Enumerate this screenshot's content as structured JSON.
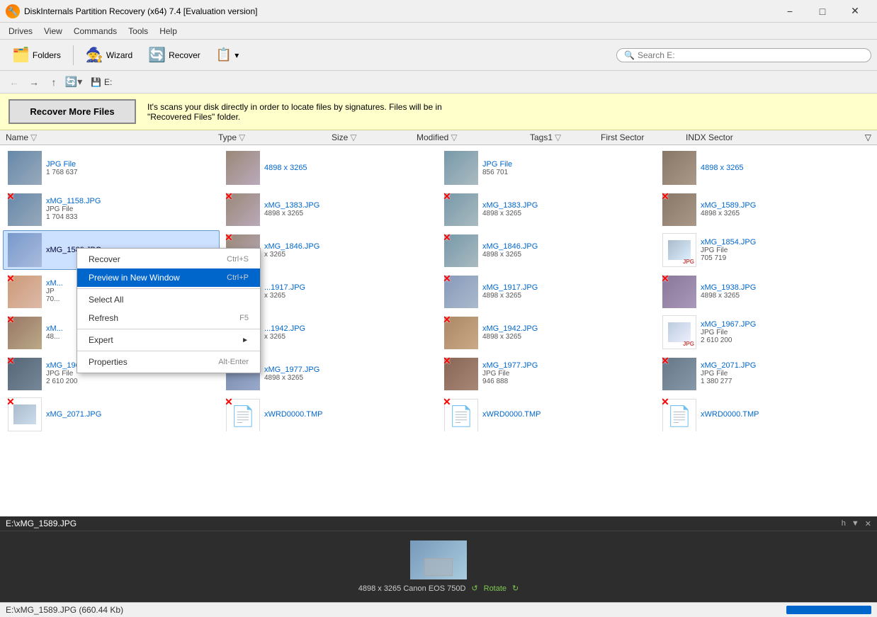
{
  "window": {
    "title": "DiskInternals Partition Recovery (x64) 7.4 [Evaluation version]"
  },
  "menu": {
    "items": [
      "Drives",
      "View",
      "Commands",
      "Tools",
      "Help"
    ]
  },
  "toolbar": {
    "folders_label": "Folders",
    "wizard_label": "Wizard",
    "recover_label": "Recover",
    "search_placeholder": "Search E:"
  },
  "nav": {
    "path": "E:"
  },
  "banner": {
    "button_label": "Recover More Files",
    "text_line1": "It's scans your disk directly in order to locate files by signatures. Files will be in",
    "text_line2": "\"Recovered Files\" folder."
  },
  "columns": {
    "name": "Name",
    "type": "Type",
    "size": "Size",
    "modified": "Modified",
    "tags1": "Tags1",
    "first_sector": "First Sector",
    "indx_sector": "INDX Sector"
  },
  "files": [
    {
      "name": "JPG File",
      "details": "4898 x 3265",
      "row": 0,
      "col": 0,
      "has_thumb": true,
      "thumb_type": "1"
    },
    {
      "name": "JPG File",
      "details": "4898 x 3265",
      "row": 0,
      "col": 1,
      "has_thumb": true,
      "thumb_type": "2"
    },
    {
      "name": "JPG File",
      "details": "856 701",
      "row": 0,
      "col": 2,
      "has_thumb": true,
      "thumb_type": "3"
    },
    {
      "name": "JPG File",
      "details": "4898 x 3265",
      "row": 0,
      "col": 3,
      "has_thumb": true,
      "thumb_type": "4"
    },
    {
      "name": "xMG_1158.JPG",
      "type": "JPG File",
      "size": "1 704 833",
      "row": 1,
      "col": 0,
      "has_x": true,
      "thumb_type": "1"
    },
    {
      "name": "xMG_1383.JPG",
      "type": "4898 x 3265",
      "row": 1,
      "col": 1,
      "has_x": true,
      "thumb_type": "2"
    },
    {
      "name": "xMG_1383.JPG",
      "type": "4898 x 3265",
      "row": 1,
      "col": 2,
      "has_x": true,
      "thumb_type": "3"
    },
    {
      "name": "xMG_1589.JPG",
      "type": "4898 x 3265",
      "row": 1,
      "col": 3,
      "has_x": true,
      "thumb_type": "4"
    },
    {
      "name": "xMG_1589.JPG",
      "selected": true,
      "row": 2,
      "col": 0,
      "has_x": false,
      "thumb_type": "5"
    },
    {
      "name": "xMG_1846.JPG",
      "details": "x 3265",
      "row": 2,
      "col": 1,
      "has_x": true,
      "thumb_type": "2"
    },
    {
      "name": "xMG_1846.JPG",
      "type": "4898 x 3265",
      "row": 2,
      "col": 2,
      "has_x": true,
      "thumb_type": "3"
    },
    {
      "name": "xMG_1854.JPG",
      "type": "JPG File",
      "size": "705 719",
      "row": 2,
      "col": 3,
      "has_x": true,
      "thumb_type": "icon"
    },
    {
      "name": "xM...",
      "type": "JP",
      "size": "70...",
      "row": 3,
      "col": 0,
      "has_x": true,
      "thumb_type": "1"
    },
    {
      "name": "...1917.JPG",
      "type": "x 3265",
      "row": 3,
      "col": 1,
      "has_x": true,
      "thumb_type": "2"
    },
    {
      "name": "xMG_1917.JPG",
      "type": "4898 x 3265",
      "row": 3,
      "col": 2,
      "has_x": true,
      "thumb_type": "3"
    },
    {
      "name": "xMG_1938.JPG",
      "type": "4898 x 3265",
      "row": 3,
      "col": 3,
      "has_x": true,
      "thumb_type": "4"
    },
    {
      "name": "xM...",
      "details": "48...",
      "row": 4,
      "col": 0,
      "has_x": true,
      "thumb_type": "1"
    },
    {
      "name": "...1942.JPG",
      "type": "x 3265",
      "row": 4,
      "col": 1,
      "has_x": true,
      "thumb_type": "2"
    },
    {
      "name": "xMG_1942.JPG",
      "type": "4898 x 3265",
      "row": 4,
      "col": 2,
      "has_x": true,
      "thumb_type": "3"
    },
    {
      "name": "xMG_1967.JPG",
      "type": "JPG File",
      "size": "2 610 200",
      "row": 4,
      "col": 3,
      "has_x": true,
      "thumb_type": "icon"
    },
    {
      "name": "xMG_1967.JPG",
      "type": "JPG File",
      "size": "2 610 200",
      "row": 5,
      "col": 0,
      "has_x": true,
      "thumb_type": "1"
    },
    {
      "name": "xMG_1977.JPG",
      "type": "4898 x 3265",
      "row": 5,
      "col": 1,
      "has_x": true,
      "thumb_type": "2"
    },
    {
      "name": "xMG_1977.JPG",
      "type": "JPG File",
      "size": "946 888",
      "row": 5,
      "col": 2,
      "has_x": true,
      "thumb_type": "3"
    },
    {
      "name": "xMG_2071.JPG",
      "type": "JPG File",
      "size": "1 380 277",
      "row": 5,
      "col": 3,
      "has_x": true,
      "thumb_type": "4"
    },
    {
      "name": "xMG_2071.JPG",
      "row": 6,
      "col": 0,
      "has_x": true,
      "thumb_type": "icon"
    },
    {
      "name": "xWRD0000.TMP",
      "row": 6,
      "col": 1,
      "has_x": true,
      "thumb_type": "doc"
    },
    {
      "name": "xWRD0000.TMP",
      "row": 6,
      "col": 2,
      "has_x": true,
      "thumb_type": "doc"
    },
    {
      "name": "xWRD0000.TMP",
      "row": 6,
      "col": 3,
      "has_x": true,
      "thumb_type": "doc"
    }
  ],
  "context_menu": {
    "items": [
      {
        "label": "Recover",
        "shortcut": "Ctrl+S",
        "highlighted": false
      },
      {
        "label": "Preview in New Window",
        "shortcut": "Ctrl+P",
        "highlighted": true
      },
      {
        "separator_after": true
      },
      {
        "label": "Select All",
        "shortcut": "",
        "highlighted": false
      },
      {
        "label": "Refresh",
        "shortcut": "F5",
        "highlighted": false
      },
      {
        "separator_after": true
      },
      {
        "label": "Expert",
        "shortcut": "▶",
        "highlighted": false
      },
      {
        "separator_after": true
      },
      {
        "label": "Properties",
        "shortcut": "Alt-Enter",
        "highlighted": false
      }
    ]
  },
  "preview": {
    "file_path": "E:\\xMG_1589.JPG",
    "dimensions": "4898 x 3265 Canon EOS 750D",
    "rotate_label": "Rotate",
    "status_text": "E:\\xMG_1589.JPG (660.44 Kb)"
  }
}
